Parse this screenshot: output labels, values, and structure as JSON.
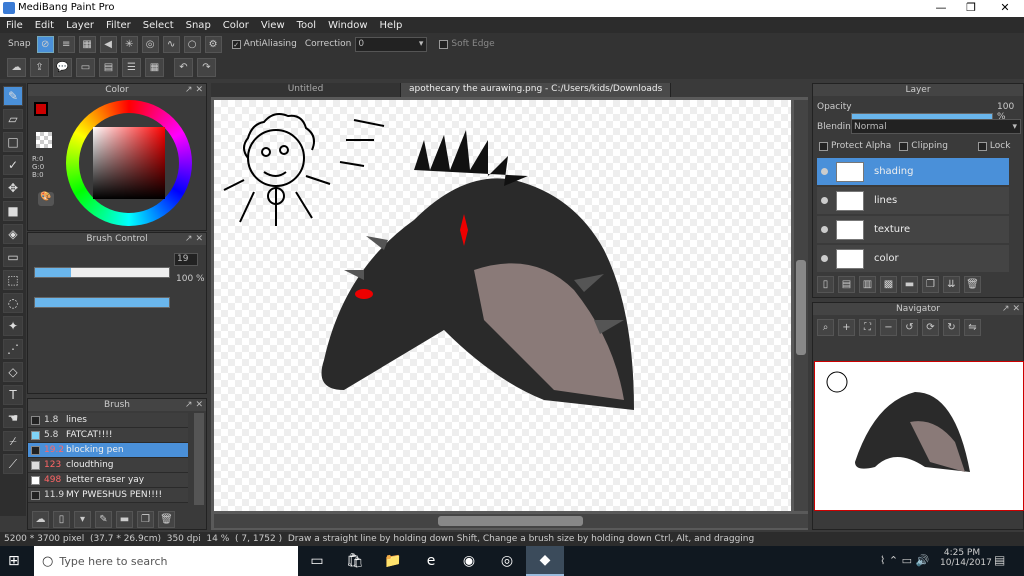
{
  "window": {
    "app_title": "MediBang Paint Pro",
    "min": "—",
    "max": "❐",
    "close": "✕"
  },
  "menu": [
    "File",
    "Edit",
    "Layer",
    "Filter",
    "Select",
    "Snap",
    "Color",
    "View",
    "Tool",
    "Window",
    "Help"
  ],
  "toolbar": {
    "snap_label": "Snap",
    "antialiasing_label": "AntiAliasing",
    "correction_label": "Correction",
    "correction_value": "0",
    "soft_edge_label": "Soft Edge"
  },
  "panels": {
    "color": {
      "title": "Color",
      "rgb": {
        "r": "R:0",
        "g": "G:0",
        "b": "B:0"
      }
    },
    "brush_control": {
      "title": "Brush Control",
      "size": "19",
      "opacity": "100 %",
      "size_fraction": 0.27,
      "opacity_fraction": 1.0
    },
    "brush": {
      "title": "Brush",
      "items": [
        {
          "size": "1.8",
          "name": "lines",
          "color": "#222222",
          "selected": false
        },
        {
          "size": "5.8",
          "name": "FATCAT!!!!",
          "color": "#7fd3f7",
          "selected": false
        },
        {
          "size": "19.2",
          "name": "blocking pen",
          "color": "#222222",
          "selected": true
        },
        {
          "size": "123",
          "name": "cloudthing",
          "color": "#dddddd",
          "selected": false
        },
        {
          "size": "498",
          "name": "better eraser yay",
          "color": "#ffffff",
          "selected": false
        },
        {
          "size": "11.9",
          "name": "MY PWESHUS PEN!!!!",
          "color": "#222222",
          "selected": false
        }
      ]
    },
    "layer": {
      "title": "Layer",
      "opacity_label": "Opacity",
      "opacity_value": "100 %",
      "blending_label": "Blending",
      "blending_value": "Normal",
      "protect_alpha": "Protect Alpha",
      "clipping": "Clipping",
      "lock": "Lock",
      "layers": [
        {
          "name": "shading",
          "selected": true
        },
        {
          "name": "lines",
          "selected": false
        },
        {
          "name": "texture",
          "selected": false
        },
        {
          "name": "color",
          "selected": false
        }
      ]
    },
    "navigator": {
      "title": "Navigator"
    }
  },
  "tabs": [
    {
      "label": "Untitled",
      "active": false
    },
    {
      "label": "apothecary the aurawing.png - C:/Users/kids/Downloads",
      "active": true
    }
  ],
  "statusbar": {
    "dimensions": "5200 * 3700 pixel",
    "size": "(37.7 * 26.9cm)",
    "dpi": "350 dpi",
    "zoom": "14 %",
    "coords": "( 7, 1752 )",
    "hint": "Draw a straight line by holding down Shift, Change a brush size by holding down Ctrl, Alt, and dragging"
  },
  "taskbar": {
    "search_placeholder": "Type here to search",
    "time": "4:25 PM",
    "date": "10/14/2017"
  },
  "colors": {
    "accent": "#4a90d9",
    "fg_color": "#cc0000",
    "bg_color": "#ffffff"
  }
}
